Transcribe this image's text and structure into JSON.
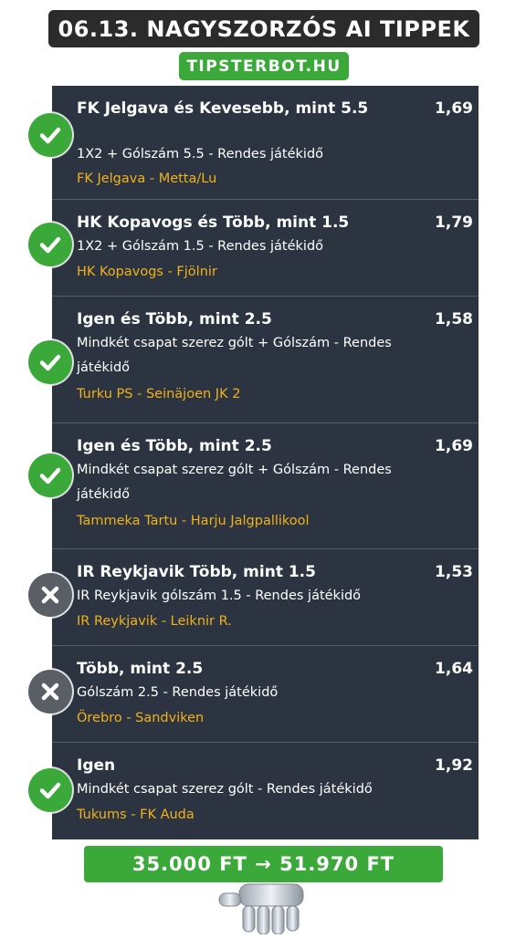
{
  "header": {
    "title": "06.13. NAGYSZORZÓS AI TIPPEK"
  },
  "brand": {
    "label": "TIPSTERBOT.HU"
  },
  "tips": [
    {
      "title": "FK Jelgava és Kevesebb, mint 5.5",
      "odds": "1,69",
      "market": "1X2 + Gólszám 5.5 - Rendes játékidő",
      "match": "FK Jelgava - Metta/Lu",
      "status": "win",
      "status_icon": "check-icon"
    },
    {
      "title": "HK Kopavogs és Több, mint 1.5",
      "odds": "1,79",
      "market": "1X2 + Gólszám 1.5 - Rendes játékidő",
      "match": "HK Kopavogs - Fjölnir",
      "status": "win",
      "status_icon": "check-icon"
    },
    {
      "title": "Igen és Több, mint 2.5",
      "odds": "1,58",
      "market": "Mindkét csapat szerez gólt + Gólszám - Rendes játékidő",
      "match": "Turku PS - Seinäjoen JK 2",
      "status": "win",
      "status_icon": "check-icon"
    },
    {
      "title": "Igen és Több, mint 2.5",
      "odds": "1,69",
      "market": "Mindkét csapat szerez gólt + Gólszám - Rendes játékidő",
      "match": "Tammeka Tartu - Harju Jalgpallikool",
      "status": "win",
      "status_icon": "check-icon"
    },
    {
      "title": "IR Reykjavik Több, mint 1.5",
      "odds": "1,53",
      "market": "IR Reykjavik gólszám 1.5 - Rendes játékidő",
      "match": "IR Reykjavik - Leiknir R.",
      "status": "loss",
      "status_icon": "cross-icon"
    },
    {
      "title": "Több, mint 2.5",
      "odds": "1,64",
      "market": "Gólszám 2.5 - Rendes játékidő",
      "match": "Örebro - Sandviken",
      "status": "loss",
      "status_icon": "cross-icon"
    },
    {
      "title": "Igen",
      "odds": "1,92",
      "market": "Mindkét csapat szerez gólt - Rendes játékidő",
      "match": "Tukums - FK Auda",
      "status": "win",
      "status_icon": "check-icon"
    }
  ],
  "footer": {
    "result": "35.000 FT → 51.970 FT"
  },
  "colors": {
    "win": "#3aa93a",
    "loss": "#5a5f66",
    "panel": "#2b3440",
    "match_text": "#f2b21a"
  }
}
